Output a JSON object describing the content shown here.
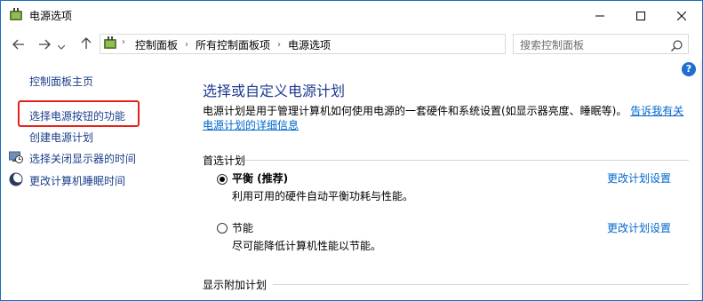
{
  "window": {
    "title": "电源选项",
    "icons": {
      "app": "power-options-icon",
      "minimize": "minimize-icon",
      "maximize": "maximize-icon",
      "close": "close-icon"
    }
  },
  "nav": {
    "back_icon": "arrow-left-icon",
    "forward_icon": "arrow-right-icon",
    "recent_icon": "chevron-down-icon",
    "up_icon": "arrow-up-icon",
    "breadcrumbs": [
      "控制面板",
      "所有控制面板项",
      "电源选项"
    ],
    "search_placeholder": "搜索控制面板"
  },
  "help": {
    "label": "?"
  },
  "sidebar": {
    "home": "控制面板主页",
    "items": [
      {
        "label": "选择电源按钮的功能",
        "icon": null,
        "highlighted": true
      },
      {
        "label": "创建电源计划",
        "icon": null
      },
      {
        "label": "选择关闭显示器的时间",
        "icon": "monitor-clock-icon"
      },
      {
        "label": "更改计算机睡眠时间",
        "icon": "moon-icon"
      }
    ]
  },
  "main": {
    "title": "选择或自定义电源计划",
    "description": "电源计划是用于管理计算机如何使用电源的一套硬件和系统设置(如显示器亮度、睡眠等)。",
    "description_link": "告诉我有关电源计划的详细信息",
    "preferred_label": "首选计划",
    "plans": [
      {
        "name": "平衡 (推荐)",
        "desc": "利用可用的硬件自动平衡功耗与性能。",
        "selected": true,
        "link": "更改计划设置"
      },
      {
        "name": "节能",
        "desc": "尽可能降低计算机性能以节能。",
        "selected": false,
        "link": "更改计划设置"
      }
    ],
    "more_plans_label": "显示附加计划"
  },
  "colors": {
    "link": "#0066cc",
    "sidebar_link": "#1b3e8a",
    "title": "#1e3b8f",
    "highlight_box": "#e4221b",
    "window_border": "#1a6fc4"
  }
}
